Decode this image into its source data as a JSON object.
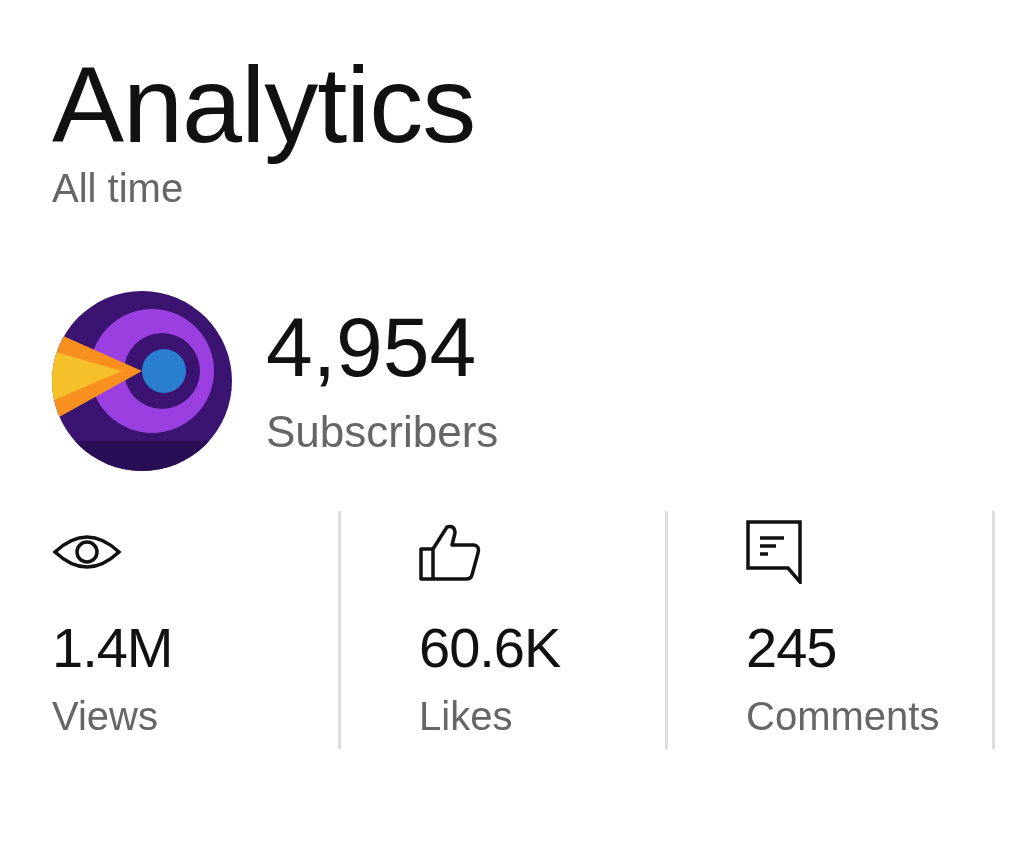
{
  "header": {
    "title": "Analytics",
    "period": "All time"
  },
  "channel": {
    "count": "4,954",
    "label": "Subscribers"
  },
  "stats": [
    {
      "kind": "views",
      "value": "1.4M",
      "label": "Views"
    },
    {
      "kind": "likes",
      "value": "60.6K",
      "label": "Likes"
    },
    {
      "kind": "comments",
      "value": "245",
      "label": "Comments"
    }
  ]
}
